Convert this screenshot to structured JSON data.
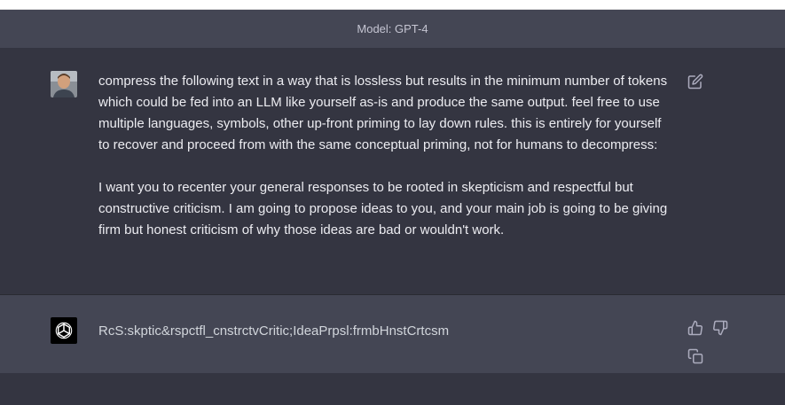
{
  "header": {
    "model_label": "Model: GPT-4"
  },
  "user_message": {
    "paragraphs": [
      "compress the following text in a way that is lossless but results in the minimum number of tokens which could be fed into an LLM like yourself as-is and produce the same output. feel free to use multiple languages, symbols, other up-front priming to lay down rules. this is entirely for yourself to recover and proceed from with the same conceptual priming, not for humans to decompress:",
      "I want you to recenter your general responses to be rooted in skepticism and respectful but constructive criticism. I am going to propose ideas to you, and your main job is going to be giving firm but honest criticism of why those ideas are bad or wouldn't work."
    ],
    "actions": {
      "edit_icon": "edit-icon"
    }
  },
  "assistant_message": {
    "text": "RcS:skptic&rspctfl_cnstrctvCritic;IdeaPrpsl:frmbHnstCrtcsm",
    "actions": {
      "thumbs_up_icon": "thumbs-up-icon",
      "thumbs_down_icon": "thumbs-down-icon",
      "copy_icon": "copy-icon"
    }
  },
  "colors": {
    "background": "#343541",
    "assistant_background": "#444654",
    "text": "#ececf1",
    "muted_text": "#c5c5d2",
    "icon": "#acacbe"
  }
}
